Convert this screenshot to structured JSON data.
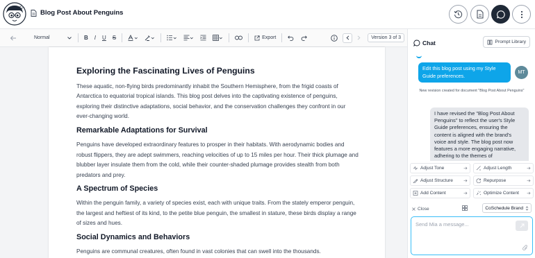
{
  "header": {
    "doc_title": "Blog Post About Penguins"
  },
  "toolbar": {
    "style_select": "Normal",
    "export_label": "Export",
    "version_label": "Version 3 of 3"
  },
  "article": {
    "h1": "Exploring the Fascinating Lives of Penguins",
    "p1": "These aquatic, non-flying birds predominantly inhabit the Southern Hemisphere, from the frigid coasts of Antarctica to equatorial tropical islands. This blog post delves into the captivating existence of penguins, exploring their distinctive adaptations, social behavior, and the conservation challenges they confront in our ever-changing world.",
    "h2a": "Remarkable Adaptations for Survival",
    "p2": "Penguins have developed extraordinary features to prosper in their habitats. With aerodynamic bodies and robust flippers, they are adept swimmers, reaching velocities of up to 15 miles per hour. Their thick plumage and blubber layer insulate them from the cold, while their counter-shaded plumage provides stealth from both predators and prey.",
    "h2b": "A Spectrum of Species",
    "p3": "Within the penguin family, a variety of species exist, each with unique traits. From the stately emperor penguin, the largest and heftiest of its kind, to the petite blue penguin, the smallest in stature, these birds display a range of sizes and hues.",
    "h2c": "Social Dynamics and Behaviors",
    "p4": "Penguins are communal creatures, often found in vast colonies that can swell into the thousands."
  },
  "chat": {
    "title": "Chat",
    "prompt_library": "Prompt Library",
    "user_message": "Edit this blog post using my Style Guide preferences.",
    "user_avatar": "MT",
    "system_note": "New revision created for document \"Blog Post About Penguins\"",
    "bot_message": "I have revised the \"Blog Post About Penguins\" to reflect the user's Style Guide preferences, ensuring the content is aligned with the brand's voice and style. The blog post now features a more engaging narrative, adhering to the themes of",
    "actions": [
      {
        "label": "Adjust Tone",
        "icon": "tone-icon"
      },
      {
        "label": "Adjust Length",
        "icon": "length-icon"
      },
      {
        "label": "Adjust Structure",
        "icon": "structure-icon"
      },
      {
        "label": "Repurpose",
        "icon": "repurpose-icon"
      },
      {
        "label": "Add Content",
        "icon": "add-content-icon"
      },
      {
        "label": "Optimize Content",
        "icon": "optimize-icon"
      }
    ],
    "close_label": "Close",
    "brand_select": "CoSchedule Brand",
    "input_placeholder": "Send Mia a message..."
  },
  "colors": {
    "accent": "#0ea5e9",
    "dark": "#1f2937"
  }
}
